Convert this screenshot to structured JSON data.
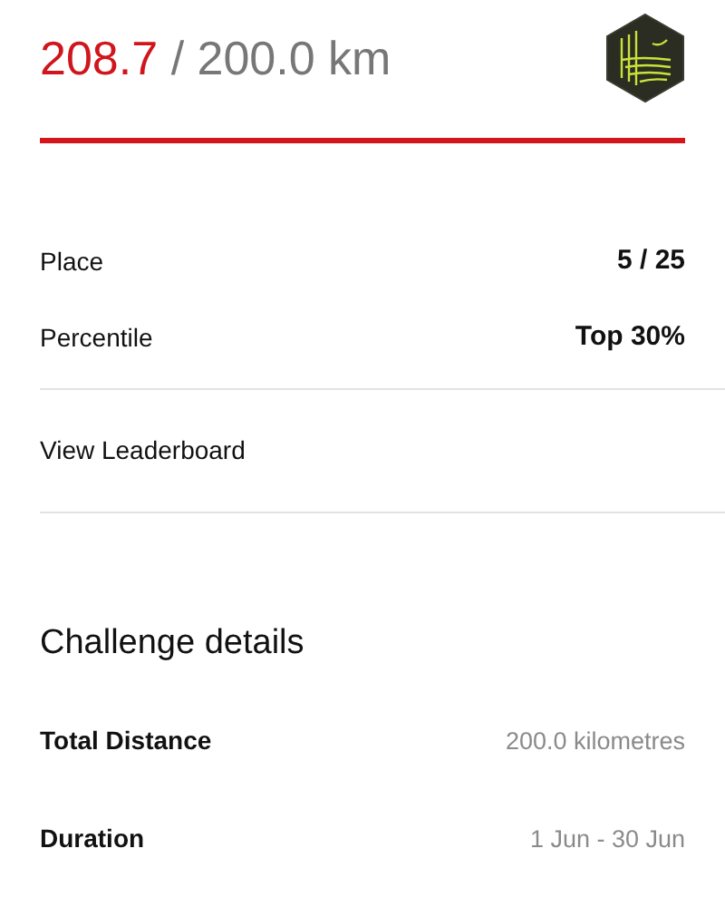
{
  "progress": {
    "current": "208.7",
    "target": "/ 200.0 km",
    "level": 1
  },
  "stats": [
    {
      "label": "Place",
      "value": "5 / 25"
    },
    {
      "label": "Percentile",
      "value": "Top 30%"
    }
  ],
  "leaderboard_link": "View Leaderboard",
  "details": {
    "title": "Challenge details",
    "rows": [
      {
        "label": "Total Distance",
        "value": "200.0 kilometres"
      },
      {
        "label": "Duration",
        "value": "1 Jun - 30 Jun"
      }
    ]
  }
}
